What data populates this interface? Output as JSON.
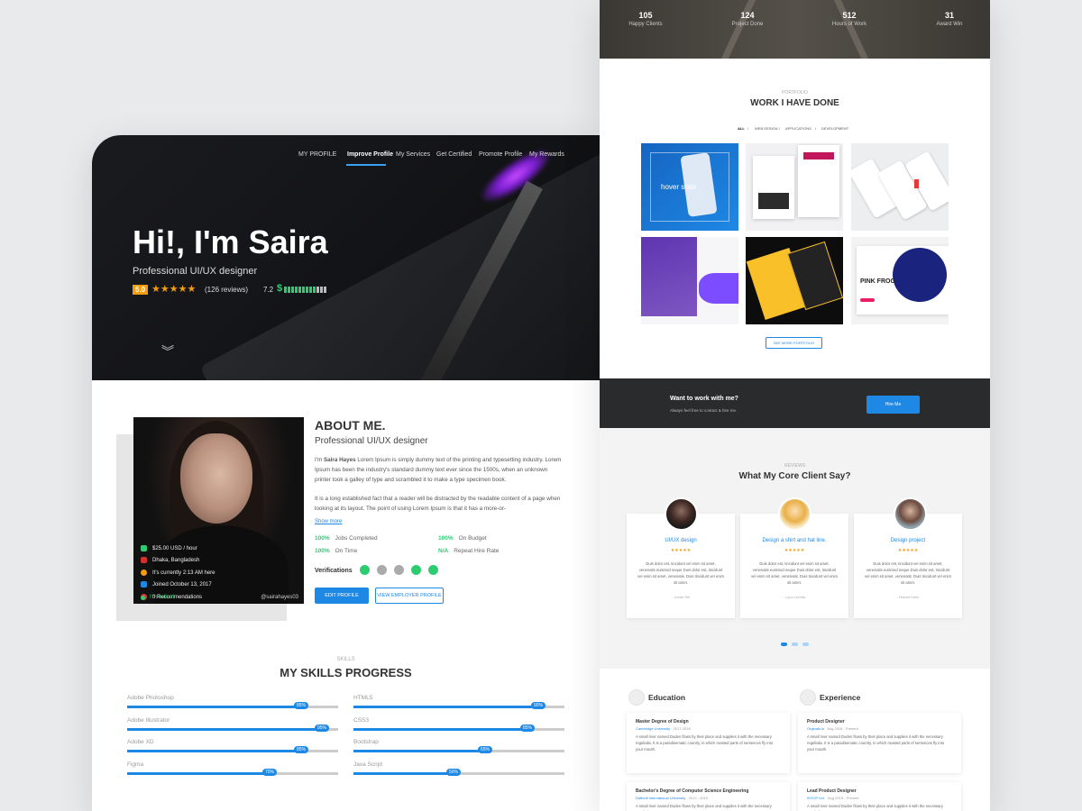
{
  "colors": {
    "accent": "#1e88e5",
    "green": "#2ecc71",
    "star": "#f39c12",
    "dark": "#141518"
  },
  "left": {
    "nav": [
      "MY PROFILE",
      "Improve Profile",
      "My Services",
      "Get Certified",
      "Promote Profile",
      "My Rewards"
    ],
    "hero": {
      "title": "Hi!, I'm Saira",
      "subtitle": "Professional UI/UX designer",
      "rating": "5.0",
      "stars": "★★★★★",
      "reviews": "(126 reviews)",
      "jss": "7.2",
      "dollar": "$",
      "jss_bar": 0.72
    },
    "profile": {
      "rate": "$25.00 USD / hour",
      "location": "Dhaka, Bangladesh",
      "time": "It's currently 2:13 AM here",
      "joined": "Joined October 13, 2017",
      "recommendations": "0 Recommendations",
      "online": "I'm online!",
      "handle": "@sairahayes03"
    },
    "about": {
      "title": "ABOUT ME.",
      "subtitle": "Professional UI/UX designer",
      "p1_pre": "I'm ",
      "p1_name": "Saira Hayes",
      "p1_rest": " Lorem Ipsum is simply dummy text of the printing and typesetting industry. Lorem Ipsum has been the industry's standard dummy text ever since the 1500s, when an unknown printer took a galley of type and scrambled it to make a type specimen book.",
      "p2": "It is a long established fact that a reader will be distracted by the readable content of a page when looking at its layout. The point of using Lorem Ipsum is that it has a more-or-",
      "show_more": "Show more",
      "stats": [
        {
          "value": "100%",
          "label": "Jobs Completed"
        },
        {
          "value": "100%",
          "label": "On Budget"
        },
        {
          "value": "100%",
          "label": "On Time"
        },
        {
          "value": "N/A",
          "label": "Repeat Hire Rate"
        }
      ],
      "verifications": "Verifications",
      "edit": "EDIT PROFILE",
      "view": "VIEW EMPLOYER PROFILE"
    },
    "skills": {
      "small": "SKILLS",
      "title": "MY SKILLS PROGRESS",
      "items": [
        {
          "name": "Adobe Photoshop",
          "pct": "85%",
          "val": 0.85
        },
        {
          "name": "HTML5",
          "pct": "90%",
          "val": 0.9
        },
        {
          "name": "Adobe Illustrator",
          "pct": "95%",
          "val": 0.95
        },
        {
          "name": "CSS3",
          "pct": "85%",
          "val": 0.85
        },
        {
          "name": "Adobe XD",
          "pct": "85%",
          "val": 0.85
        },
        {
          "name": "Bootstrap",
          "pct": "65%",
          "val": 0.65
        },
        {
          "name": "Figma",
          "pct": "70%",
          "val": 0.7
        },
        {
          "name": "Java Script",
          "pct": "50%",
          "val": 0.5
        }
      ]
    }
  },
  "right": {
    "stats": [
      {
        "n": "105",
        "l": "Happy Clients"
      },
      {
        "n": "124",
        "l": "Project Done"
      },
      {
        "n": "512",
        "l": "Hours of Work"
      },
      {
        "n": "31",
        "l": "Award Win"
      }
    ],
    "portfolio": {
      "small": "PORTFOLIO",
      "title": "WORK I HAVE DONE",
      "tabs": [
        "ALL",
        "/",
        "WEB DESIGN",
        "/",
        "APPLICATIONS",
        "/",
        "DEVELOPMENT"
      ],
      "hover": "hover state",
      "pink": "PINK FROG",
      "see_more": "SEE MORE PORTFOLIO"
    },
    "cta": {
      "title": "Want to work with me?",
      "sub": "Always feel free to contact & hire me.",
      "button": "Hire Me"
    },
    "reviews": {
      "small": "REVIEWS",
      "title": "What My Core Client Say?",
      "items": [
        {
          "title": "UI/UX design",
          "stars": "★★★★★",
          "body": "Duis dolor est, tincidunt vel enim sit amet, venenatis euismod neque Duis dolor est, tincidunt vel enim sit amet, venenatis. Duis tincidunt vel enim sit amet.",
          "author": "- Jonah Hill"
        },
        {
          "title": "Design a shirt and hat line.",
          "stars": "★★★★★",
          "body": "Duis dolor est, tincidunt vel enim sit amet, venenatis euismod neque Duis dolor est, tincidunt vel enim sit amet, venenatis. Duis tincidunt vel enim sit amet.",
          "author": "- Lyca Loretta"
        },
        {
          "title": "Design project",
          "stars": "★★★★★",
          "body": "Duis dolor est, tincidunt vel enim sit amet, venenatis euismod neque Duis dolor est, tincidunt vel enim sit amet, venenatis. Duis tincidunt vel enim sit amet.",
          "author": "- Robert Delin"
        }
      ]
    },
    "education": {
      "title": "Education",
      "items": [
        {
          "h": "Master Degree of Design",
          "org": "Cambridge University",
          "date": "2017-2018",
          "d": "A small river named Duden flows by their place and supplies it with the necessary regelialia. It is a paradisematic country, in which roasted parts of sentences fly into your mouth."
        },
        {
          "h": "Bachelor's Degree of Computer Science Engineering",
          "org": "Daffodil International University",
          "date": "2012 - 2015",
          "d": "A small river named Duden flows by their place and supplies it with the necessary regelialia."
        }
      ]
    },
    "experience": {
      "title": "Experience",
      "items": [
        {
          "h": "Product Designer",
          "org": "Orginals.io",
          "date": "Aug 2018 - Present",
          "d": "A small river named Duden flows by their place and supplies it with the necessary regelialia. It is a paradisematic country, in which roasted parts of sentences fly into your mouth."
        },
        {
          "h": "Lead Product Designer",
          "org": "INTOP Ltd.",
          "date": "Aug 2015 - Present",
          "d": "A small river named Duden flows by their place and supplies it with the necessary regelialia."
        }
      ]
    }
  }
}
